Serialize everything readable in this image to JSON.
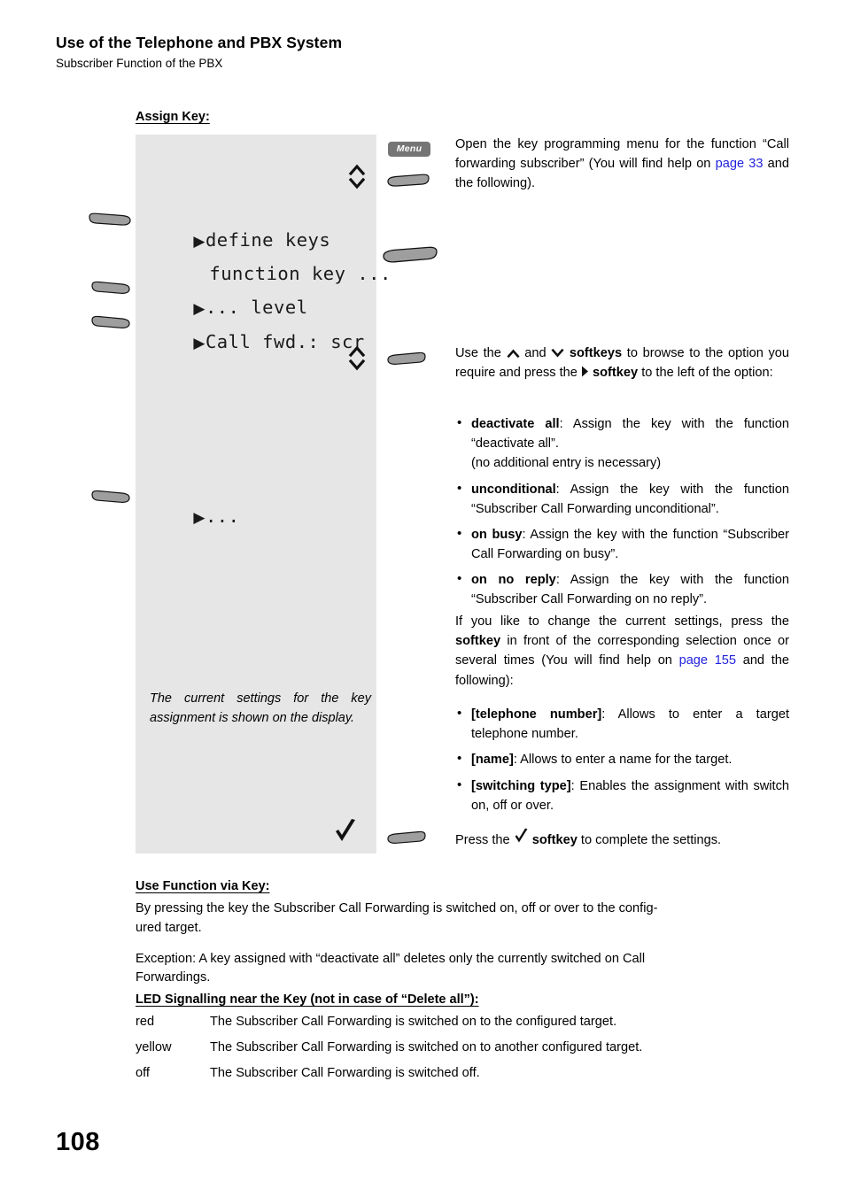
{
  "header": {
    "title": "Use of the Telephone and PBX System",
    "subtitle": "Subscriber Function of the PBX"
  },
  "assign_key": {
    "heading": "Assign Key:"
  },
  "display": {
    "lines": [
      {
        "marker": "▶",
        "text": "define keys"
      },
      {
        "marker": "",
        "text": "function key ..."
      },
      {
        "marker": "▶",
        "text": "... level"
      },
      {
        "marker": "▶",
        "text": "Call fwd.: scr"
      },
      {
        "marker": "▶",
        "text": "..."
      }
    ],
    "note": "The current settings for the key assignment is shown on the display.",
    "confirm_icon": "check-icon",
    "scroll_up_icon": "chevron-up-icon",
    "scroll_down_icon": "chevron-down-icon"
  },
  "keys": {
    "menu_label": "Menu",
    "softkey_icon": "softkey-pill-icon"
  },
  "steps": [
    {
      "id": "open-menu",
      "text_parts": {
        "before": "Open the key programming menu for the function “Call forwarding subscriber” (You will find help on ",
        "link": "page 33",
        "after": " and the following)."
      }
    },
    {
      "id": "browse-options",
      "intro_parts": {
        "p1": "Use the ",
        "p2": " and ",
        "p3": " ",
        "bold1": "softkeys",
        "p4": " to browse to the option you require and press the ",
        "bold2": "softkey",
        "p5": " to the left of the option:"
      },
      "options": [
        {
          "label": "deactivate all",
          "desc": ": Assign the key with the function “deactivate all”.",
          "extra": "(no additional entry is necessary)"
        },
        {
          "label": "unconditional",
          "desc": ": Assign the key with the function “Subscriber Call Forwarding unconditional”.",
          "extra": ""
        },
        {
          "label": "on busy",
          "desc": ": Assign the key with the function “Subscriber Call Forwarding on busy”.",
          "extra": ""
        },
        {
          "label": "on no reply",
          "desc": ": Assign the key with the function “Subscriber Call Forwarding on no reply”.",
          "extra": ""
        }
      ],
      "change_intro": {
        "before": "If you like to change the current settings, press the ",
        "bold": "softkey",
        "middle": " in front of the corresponding selection once or several times (You will find help on ",
        "link": "page 155",
        "after": " and the following):"
      },
      "settings": [
        {
          "label": "[telephone number]",
          "desc": ": Allows to enter a target telephone number."
        },
        {
          "label": "[name]",
          "desc": ": Allows to enter a name for the target."
        },
        {
          "label": "[switching type]",
          "desc": ": Enables the assignment with switch on, off or over."
        }
      ]
    },
    {
      "id": "confirm",
      "text_parts": {
        "before": "Press the ",
        "bold": "softkey",
        "after": " to complete the settings."
      }
    }
  ],
  "use_function": {
    "heading": "Use Function via Key:",
    "para1": "By pressing the key the Subscriber Call Forwarding is switched on, off or over to the configured target.",
    "para1_last": "ured target.",
    "para1_first": "By pressing the key the Subscriber Call Forwarding is switched on, off or over to the config-",
    "para2_first": "Exception: A key assigned with “deactivate all” deletes only the currently switched on Call",
    "para2_last": "Forwardings."
  },
  "led": {
    "heading": "LED Signalling near the Key (not in case of “Delete all”):",
    "rows": [
      {
        "color": "red",
        "desc": "The Subscriber Call Forwarding is switched on to the configured target."
      },
      {
        "color": "yellow",
        "desc": "The Subscriber Call Forwarding is switched on to another configured target."
      },
      {
        "color": "off",
        "desc": "The Subscriber Call Forwarding is switched off."
      }
    ]
  },
  "footer": {
    "page_number": "108"
  },
  "colors": {
    "link": "#2222dd",
    "lcd_background": "#e6e6e6",
    "softkey_fill": "#9e9e9e",
    "menu_button": "#757575"
  }
}
